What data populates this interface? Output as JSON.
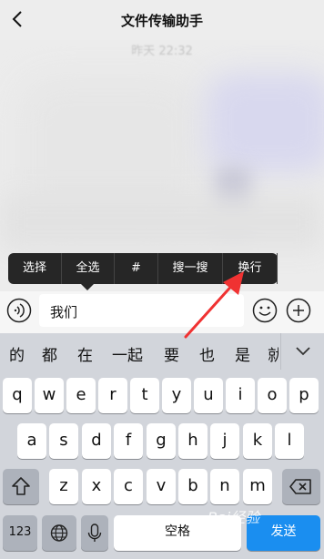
{
  "header": {
    "title": "文件传输助手"
  },
  "chat": {
    "timestamp": "昨天 22:32"
  },
  "context_menu": {
    "items": [
      "选择",
      "全选",
      "#",
      "搜一搜",
      "换行"
    ]
  },
  "input": {
    "value": "我们"
  },
  "candidates": [
    "的",
    "都",
    "在",
    "一起",
    "要",
    "也",
    "是",
    "就"
  ],
  "keyboard": {
    "row1": [
      "q",
      "w",
      "e",
      "r",
      "t",
      "y",
      "u",
      "i",
      "o",
      "p"
    ],
    "row2": [
      "a",
      "s",
      "d",
      "f",
      "g",
      "h",
      "j",
      "k",
      "l"
    ],
    "row3": [
      "z",
      "x",
      "c",
      "v",
      "b",
      "n",
      "m"
    ],
    "num_label": "123",
    "space_label": "空格",
    "send_label": "发送"
  },
  "watermark": "Bai经验",
  "colors": {
    "accent": "#1a8ef0",
    "menu_bg": "#262626",
    "arrow": "#f03232"
  }
}
